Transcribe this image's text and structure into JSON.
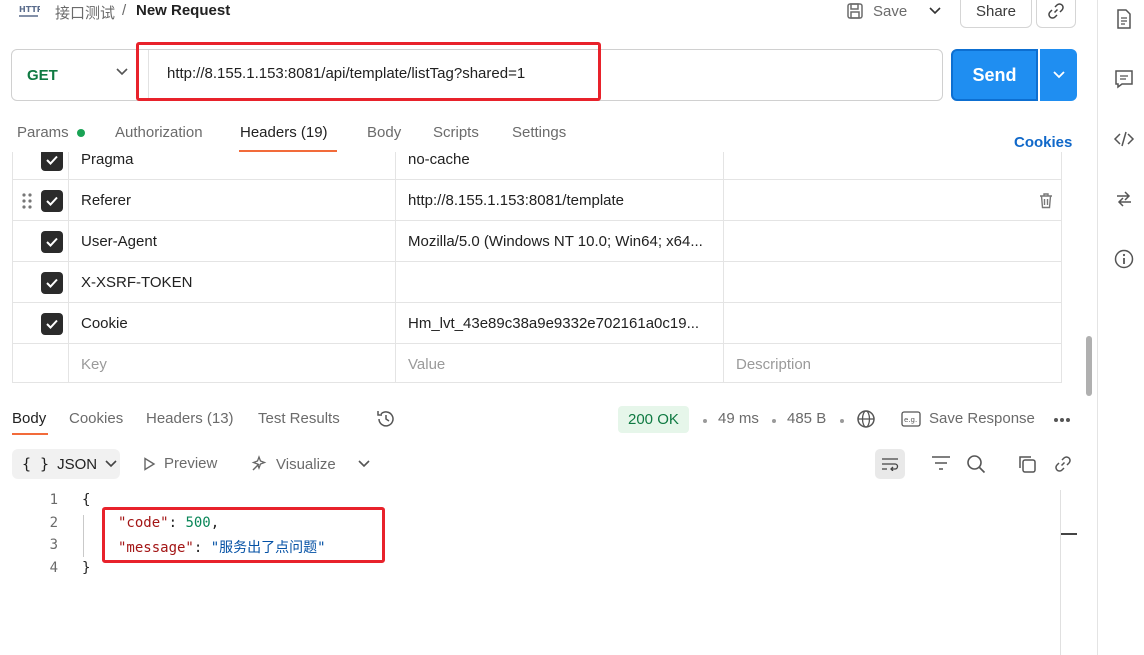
{
  "header": {
    "collection": "接口测试",
    "separator": "/",
    "title": "New Request",
    "save_label": "Save",
    "share_label": "Share"
  },
  "request": {
    "method": "GET",
    "url": "http://8.155.1.153:8081/api/template/listTag?shared=1",
    "send_label": "Send"
  },
  "request_tabs": {
    "params": "Params",
    "authorization": "Authorization",
    "headers": "Headers (19)",
    "body": "Body",
    "scripts": "Scripts",
    "settings": "Settings",
    "cookies": "Cookies"
  },
  "headers_table": {
    "rows": [
      {
        "key": "Pragma",
        "value": "no-cache"
      },
      {
        "key": "Referer",
        "value": "http://8.155.1.153:8081/template"
      },
      {
        "key": "User-Agent",
        "value": "Mozilla/5.0 (Windows NT 10.0; Win64; x64..."
      },
      {
        "key": "X-XSRF-TOKEN",
        "value": ""
      },
      {
        "key": "Cookie",
        "value": "Hm_lvt_43e89c38a9e9332e702161a0c19..."
      }
    ],
    "placeholder": {
      "key": "Key",
      "value": "Value",
      "description": "Description"
    }
  },
  "response_tabs": {
    "body": "Body",
    "cookies": "Cookies",
    "headers": "Headers (13)",
    "test_results": "Test Results"
  },
  "response_meta": {
    "status": "200 OK",
    "time": "49 ms",
    "size": "485 B",
    "save_response": "Save Response"
  },
  "response_toolbar": {
    "format": "JSON",
    "preview": "Preview",
    "visualize": "Visualize"
  },
  "response_body": {
    "line_numbers": [
      "1",
      "2",
      "3",
      "4"
    ],
    "open_brace": "{",
    "close_brace": "}",
    "code_key": "\"code\"",
    "code_value": "500",
    "message_key": "\"message\"",
    "message_value": "\"服务出了点问题\""
  },
  "colors": {
    "accent": "#f26b3a",
    "send": "#1f8ef1",
    "method_get": "#0f7a42",
    "highlight_box": "#e8222b"
  }
}
